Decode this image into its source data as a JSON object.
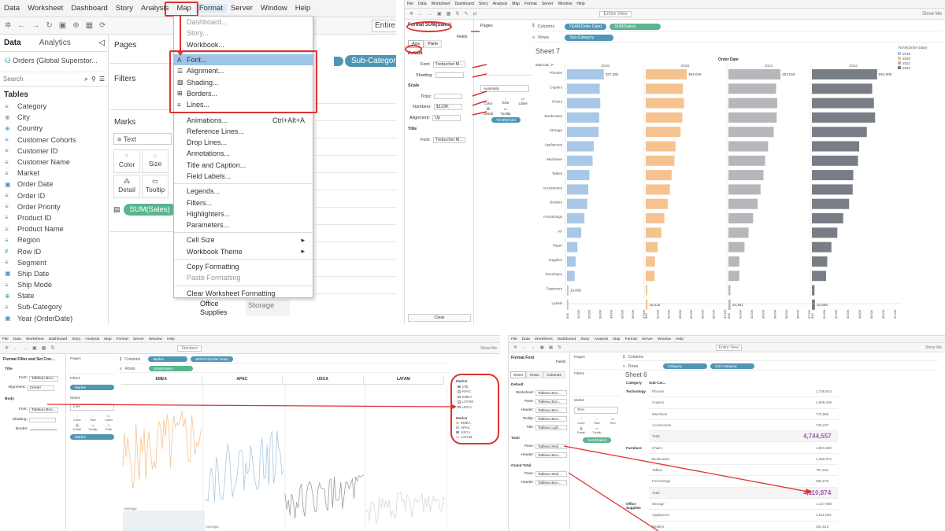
{
  "q1": {
    "menu": [
      "Data",
      "Worksheet",
      "Dashboard",
      "Story",
      "Analysis",
      "Map",
      "Format",
      "Server",
      "Window",
      "Help"
    ],
    "tabs": {
      "data": "Data",
      "analytics": "Analytics"
    },
    "datasource": "Orders (Global Superstor...",
    "search_placeholder": "Search",
    "tables_label": "Tables",
    "fields": [
      "Category",
      "City",
      "Country",
      "Customer Cohorts",
      "Customer ID",
      "Customer Name",
      "Market",
      "Order Date",
      "Order ID",
      "Order Priority",
      "Product ID",
      "Product Name",
      "Region",
      "Row ID",
      "Segment",
      "Ship Date",
      "Ship Mode",
      "State",
      "Sub-Category",
      "Year (OrderDate)"
    ],
    "pages_label": "Pages",
    "filters_label": "Filters",
    "marks_label": "Marks",
    "marks_type": "Text",
    "marks_buttons": [
      "Color",
      "Size",
      "Detail",
      "Tooltip"
    ],
    "sum_sales": "SUM(Sales)",
    "subcategory_pill": "Sub-Category",
    "entire": "Entire",
    "format_menu": {
      "items": [
        "Dashboard...",
        "Story...",
        "Workbook...",
        "Font...",
        "Alignment...",
        "Shading...",
        "Borders...",
        "Lines...",
        "Animations...",
        "Reference Lines...",
        "Drop Lines...",
        "Annotations...",
        "Title and Caption...",
        "Field Labels...",
        "Legends...",
        "Filters...",
        "Highlighters...",
        "Parameters...",
        "Cell Size",
        "Workbook Theme",
        "Copy Formatting",
        "Paste Formatting",
        "Clear Worksheet Formatting"
      ],
      "shortcut": "Ctrl+Alt+A"
    },
    "bottom_tabs": {
      "office": "Office Supplies",
      "storage": "Storage"
    }
  },
  "q2": {
    "menu": [
      "File",
      "Data",
      "Worksheet",
      "Dashboard",
      "Story",
      "Analysis",
      "Map",
      "Format",
      "Server",
      "Window",
      "Help"
    ],
    "view": "Entire View",
    "show_me": "Show Me",
    "format_title": "Format SUM(Sales)",
    "fields_label": "Fields",
    "tabs": [
      "Axis",
      "Pane"
    ],
    "default": "Default",
    "font_label": "Font:",
    "font_value": "Trebuchet M...",
    "shading_label": "Shading:",
    "scale": "Scale",
    "ticks_label": "Ticks:",
    "numbers_label": "Numbers:",
    "numbers_value": "$123K",
    "alignment_label": "Alignment:",
    "alignment_value": "Up",
    "title_label": "Title",
    "title_font_value": "Trebuchet M...",
    "clear": "Clear",
    "pages": "Pages",
    "columns": "Columns",
    "rows": "Rows",
    "col_pill1": "YEAR(Order Date)",
    "col_pill2": "SUM(Sales)",
    "row_pill": "Sub-Category",
    "marks_auto": "Automatic",
    "marks_btns": [
      "Color",
      "Size",
      "Label",
      "Detail",
      "Tooltip"
    ],
    "year_pill": "YEAR(Order",
    "sheet": "Sheet 7",
    "subcat_header": "Sub-Cat.. F",
    "order_date": "Order Date",
    "legend_title": "YEAR(Order Date)",
    "legend": [
      "2019",
      "2020",
      "2021",
      "2022"
    ]
  },
  "chart_data": {
    "type": "bar",
    "title": "Sheet 7",
    "xlabel": "",
    "ylabel": "Sub-Category",
    "categories": [
      "Phones",
      "Copiers",
      "Chairs",
      "Bookcases",
      "Storage",
      "Appliances",
      "Machines",
      "Tables",
      "Accessories",
      "Binders",
      "Furnishings",
      "Art",
      "Paper",
      "Supplies",
      "Envelopes",
      "Fasteners",
      "Labels"
    ],
    "series": [
      {
        "name": "2019",
        "color": "#a9c7e6",
        "values": [
          337282,
          300000,
          305000,
          295000,
          290000,
          245000,
          235000,
          205000,
          195000,
          185000,
          160000,
          130000,
          95000,
          80000,
          70000,
          13609,
          12000
        ]
      },
      {
        "name": "2020",
        "color": "#f6c390",
        "values": [
          364016,
          330000,
          340000,
          325000,
          310000,
          265000,
          255000,
          230000,
          215000,
          195000,
          165000,
          140000,
          105000,
          82000,
          78000,
          14000,
          15518
        ]
      },
      {
        "name": "2021",
        "color": "#b5b7bb",
        "values": [
          453519,
          415000,
          425000,
          420000,
          395000,
          345000,
          320000,
          305000,
          280000,
          255000,
          215000,
          175000,
          140000,
          95000,
          95000,
          17000,
          18381
        ]
      },
      {
        "name": "2022",
        "color": "#797d85",
        "values": [
          552006,
          510000,
          525000,
          535000,
          465000,
          400000,
          390000,
          350000,
          345000,
          315000,
          265000,
          215000,
          165000,
          130000,
          120000,
          22000,
          25889
        ]
      }
    ],
    "data_labels": {
      "2019_Phones": "337,282",
      "2020_Phones": "364,016",
      "2021_Phones": "453,519",
      "2022_Phones": "552,006",
      "2019_Fasteners": "13,609",
      "2020_Labels": "15,518",
      "2021_Labels": "18,381",
      "2022_Labels": "25,889"
    },
    "xticks": [
      "$0K",
      "$100K",
      "$200K",
      "$300K",
      "$400K",
      "$500K",
      "$600K",
      "$700K"
    ],
    "xlim": [
      0,
      700000
    ]
  },
  "q3": {
    "menu": [
      "File",
      "Data",
      "Worksheet",
      "Dashboard",
      "Story",
      "Analysis",
      "Map",
      "Format",
      "Server",
      "Window",
      "Help"
    ],
    "panel_title": "Format Filter and Set Con...",
    "title": "Title",
    "font_label": "Font:",
    "font_value": "Tableau Boo...",
    "alignment_label": "Alignment:",
    "alignment_value": "Center",
    "body": "Body",
    "body_font_value": "Tableau Boo...",
    "shading_label": "Shading:",
    "border_label": "Border:",
    "pages": "Pages",
    "filters": "Filters",
    "filter_pill": "Market",
    "marks": "Marks",
    "marks_type": "Line",
    "mark_btns": [
      "Color",
      "Size",
      "Label",
      "Detail",
      "Tooltip",
      "Path"
    ],
    "market_pill": "Market",
    "columns": "Columns",
    "rows": "Rows",
    "col_pill1": "Market",
    "col_pill2": "MONTH(Order Date)",
    "row_pill": "SUM(Sales)",
    "standard": "Standard",
    "show_me": "Show Me",
    "headers": [
      "EMEA",
      "APAC",
      "USCA",
      "LATAM"
    ],
    "average": "Average",
    "filter_card_title": "Market",
    "filter_options": [
      "(All)",
      "APAC",
      "EMEA",
      "LATAM",
      "USCA"
    ],
    "legend_title": "Market",
    "legend": [
      "EMEA",
      "APAC",
      "USCA",
      "LATAM"
    ]
  },
  "q4": {
    "menu": [
      "File",
      "Data",
      "Worksheet",
      "Dashboard",
      "Story",
      "Analysis",
      "Map",
      "Format",
      "Server",
      "Window",
      "Help"
    ],
    "view": "Entire View",
    "show_me": "Show Me",
    "panel_title": "Format Font",
    "fields_label": "Fields",
    "tabs": [
      "Sheet",
      "Rows",
      "Columns"
    ],
    "default": "Default",
    "labels": [
      "Worksheet:",
      "Pane:",
      "Header:",
      "Tooltip:",
      "Title:"
    ],
    "values": [
      "Tableau Boo...",
      "Tableau Boo...",
      "Tableau Boo...",
      "Tableau Boo...",
      "Tableau Ligh..."
    ],
    "total": "Total",
    "total_pane_value": "Tableau Med...",
    "total_header_value": "Tableau Boo...",
    "grand_total": "Grand Total",
    "grand_pane_value": "Tableau Med...",
    "grand_header_value": "Tableau Boo...",
    "pane_label": "Pane:",
    "header_label": "Header:",
    "pages": "Pages",
    "filters": "Filters",
    "marks": "Marks",
    "marks_type": "Text",
    "mark_btns": [
      "Color",
      "Size",
      "Text",
      "Detail",
      "Tooltip"
    ],
    "sum_pill": "SUM(Sales)",
    "columns": "Columns",
    "rows": "Rows",
    "row_pill1": "Category",
    "row_pill2": "Sub-Category",
    "sheet": "Sheet 6",
    "col_headers": [
      "Category",
      "Sub-Cat..."
    ],
    "table": [
      {
        "cat": "Technology",
        "sub": "Phones",
        "val": "1,706,824"
      },
      {
        "cat": "",
        "sub": "Copiers",
        "val": "1,509,436"
      },
      {
        "cat": "",
        "sub": "Machines",
        "val": "779,060"
      },
      {
        "cat": "",
        "sub": "Accessories",
        "val": "749,237"
      },
      {
        "cat": "",
        "sub": "Total",
        "val": "4,744,557",
        "total": true
      },
      {
        "cat": "Furniture",
        "sub": "Chairs",
        "val": "1,501,682"
      },
      {
        "cat": "",
        "sub": "Bookcases",
        "val": "1,466,572"
      },
      {
        "cat": "",
        "sub": "Tables",
        "val": "757,042"
      },
      {
        "cat": "",
        "sub": "Furnishings",
        "val": "385,578"
      },
      {
        "cat": "",
        "sub": "Total",
        "val": "4,110,874",
        "total": true
      },
      {
        "cat": "Office Supplies",
        "sub": "Storage",
        "val": "1,127,086"
      },
      {
        "cat": "",
        "sub": "Appliances",
        "val": "1,011,064"
      },
      {
        "cat": "",
        "sub": "Binders",
        "val": "461,912"
      }
    ],
    "total_color": "#9b5fa8"
  },
  "colors": {
    "accent_red": "#d33333",
    "pill_blue": "#4f96b5",
    "pill_green": "#5ab58f",
    "menu_highlight": "#9ec5e8"
  }
}
